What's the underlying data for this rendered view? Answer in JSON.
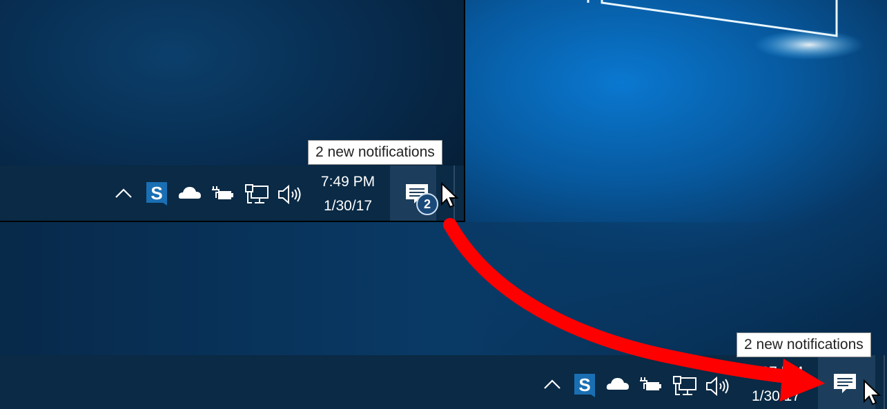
{
  "top_taskbar": {
    "time": "7:49 PM",
    "date": "1/30/17",
    "tooltip": "2 new notifications",
    "notification_count": "2",
    "tray_icons": [
      "chevron-up-icon",
      "sync-s-icon",
      "onedrive-cloud-icon",
      "battery-plug-icon",
      "network-icon",
      "speaker-icon"
    ]
  },
  "bottom_taskbar": {
    "time": "8:27 PM",
    "date": "1/30/17",
    "tooltip": "2 new notifications",
    "tray_icons": [
      "chevron-up-icon",
      "sync-s-icon",
      "onedrive-cloud-icon",
      "battery-plug-icon",
      "network-icon",
      "speaker-icon"
    ]
  },
  "colors": {
    "taskbar": "#0a2a45",
    "action_center_highlight": "#1c3e5c",
    "arrow": "#ff0000",
    "desktop": "#0a78d0"
  }
}
